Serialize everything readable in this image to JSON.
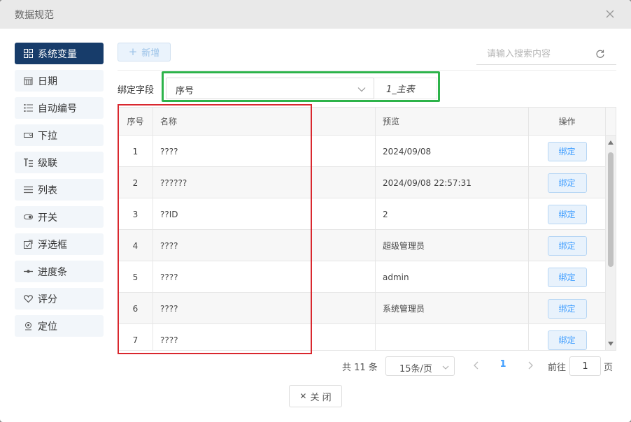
{
  "dialog": {
    "title": "数据规范"
  },
  "sidebar": {
    "items": [
      {
        "label": "系统变量",
        "icon": "grid-icon",
        "active": true
      },
      {
        "label": "日期",
        "icon": "calendar-icon"
      },
      {
        "label": "自动编号",
        "icon": "numbered-list-icon"
      },
      {
        "label": "下拉",
        "icon": "dropdown-icon"
      },
      {
        "label": "级联",
        "icon": "cascade-icon"
      },
      {
        "label": "列表",
        "icon": "list-icon"
      },
      {
        "label": "开关",
        "icon": "toggle-icon"
      },
      {
        "label": "浮选框",
        "icon": "popup-select-icon"
      },
      {
        "label": "进度条",
        "icon": "progress-icon"
      },
      {
        "label": "评分",
        "icon": "heart-icon"
      },
      {
        "label": "定位",
        "icon": "location-icon"
      }
    ]
  },
  "toolbar": {
    "add_label": "新增",
    "search_placeholder": "请输入搜索内容"
  },
  "bind": {
    "label": "绑定字段",
    "field_value": "序号",
    "table_value": "1_主表"
  },
  "table": {
    "headers": [
      "序号",
      "名称",
      "预览",
      "操作"
    ],
    "rows": [
      {
        "index": "1",
        "name": "????",
        "preview": "2024/09/08",
        "action": "绑定"
      },
      {
        "index": "2",
        "name": "??????",
        "preview": "2024/09/08 22:57:31",
        "action": "绑定"
      },
      {
        "index": "3",
        "name": "??ID",
        "preview": "2",
        "action": "绑定"
      },
      {
        "index": "4",
        "name": "????",
        "preview": "超级管理员",
        "action": "绑定"
      },
      {
        "index": "5",
        "name": "????",
        "preview": "admin",
        "action": "绑定"
      },
      {
        "index": "6",
        "name": "????",
        "preview": "系统管理员",
        "action": "绑定"
      },
      {
        "index": "7",
        "name": "????",
        "preview": "",
        "action": "绑定"
      }
    ]
  },
  "pagination": {
    "total_text": "共 11 条",
    "page_size": "15条/页",
    "current_page": "1",
    "goto_label": "前往",
    "goto_value": "1",
    "page_suffix": "页"
  },
  "footer": {
    "close_label": "关 闭"
  },
  "colors": {
    "accent": "#409eff",
    "sidebar_active": "#173c6a",
    "highlight_green": "#2db34a",
    "highlight_red": "#d9272e"
  }
}
